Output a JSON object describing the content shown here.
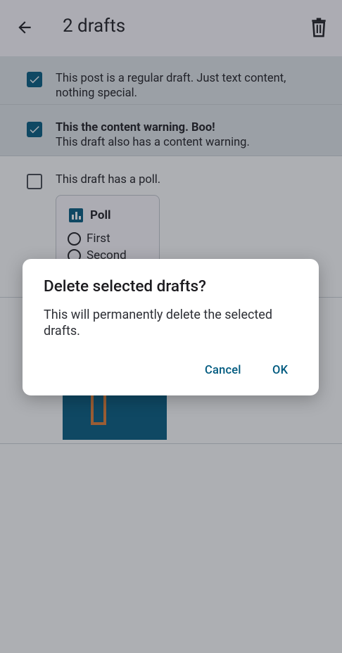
{
  "appbar": {
    "title": "2 drafts"
  },
  "drafts": [
    {
      "checked": true,
      "text": "This post is a regular draft. Just text content, nothing special."
    },
    {
      "checked": true,
      "cw": "This the content warning. Boo!",
      "text": "This draft also has a content warning."
    },
    {
      "checked": false,
      "text": "This draft has a poll.",
      "poll": {
        "title": "Poll",
        "options": [
          "First",
          "Second"
        ]
      }
    },
    {
      "checked": false,
      "has_media": true
    }
  ],
  "dialog": {
    "title": "Delete selected drafts?",
    "body": "This will permanently delete the selected drafts.",
    "cancel": "Cancel",
    "ok": "OK"
  },
  "colors": {
    "accent": "#005a7f",
    "media_bg": "#005a7f",
    "media_accent": "#e07b33"
  }
}
